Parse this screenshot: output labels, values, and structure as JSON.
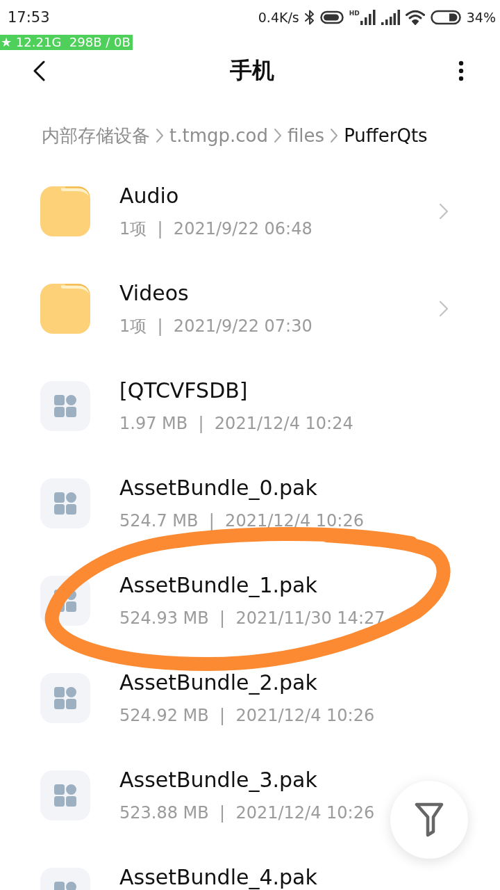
{
  "status_bar": {
    "time": "17:53",
    "net_speed": "0.4K/s",
    "signal_label": "HD",
    "battery": "34%"
  },
  "net_overlay": {
    "text": "★ 12.21G  298B / 0B"
  },
  "header": {
    "title": "手机"
  },
  "breadcrumb": [
    {
      "label": "内部存储设备",
      "current": false
    },
    {
      "label": "t.tmgp.cod",
      "current": false
    },
    {
      "label": "files",
      "current": false
    },
    {
      "label": "PufferQts",
      "current": true
    }
  ],
  "items": [
    {
      "kind": "folder",
      "name": "Audio",
      "meta": "1项  |  2021/9/22 06:48",
      "circled": false
    },
    {
      "kind": "folder",
      "name": "Videos",
      "meta": "1项  |  2021/9/22 07:30",
      "circled": false
    },
    {
      "kind": "file",
      "name": "[QTCVFSDB]",
      "meta": "1.97 MB  |  2021/12/4 10:24",
      "circled": false
    },
    {
      "kind": "file",
      "name": "AssetBundle_0.pak",
      "meta": "524.7 MB  |  2021/12/4 10:26",
      "circled": false
    },
    {
      "kind": "file",
      "name": "AssetBundle_1.pak",
      "meta": "524.93 MB  |  2021/11/30 14:27",
      "circled": true
    },
    {
      "kind": "file",
      "name": "AssetBundle_2.pak",
      "meta": "524.92 MB  |  2021/12/4 10:26",
      "circled": false
    },
    {
      "kind": "file",
      "name": "AssetBundle_3.pak",
      "meta": "523.88 MB  |  2021/12/4 10:26",
      "circled": false
    },
    {
      "kind": "file",
      "name": "AssetBundle_4.pak",
      "circled": false
    }
  ]
}
